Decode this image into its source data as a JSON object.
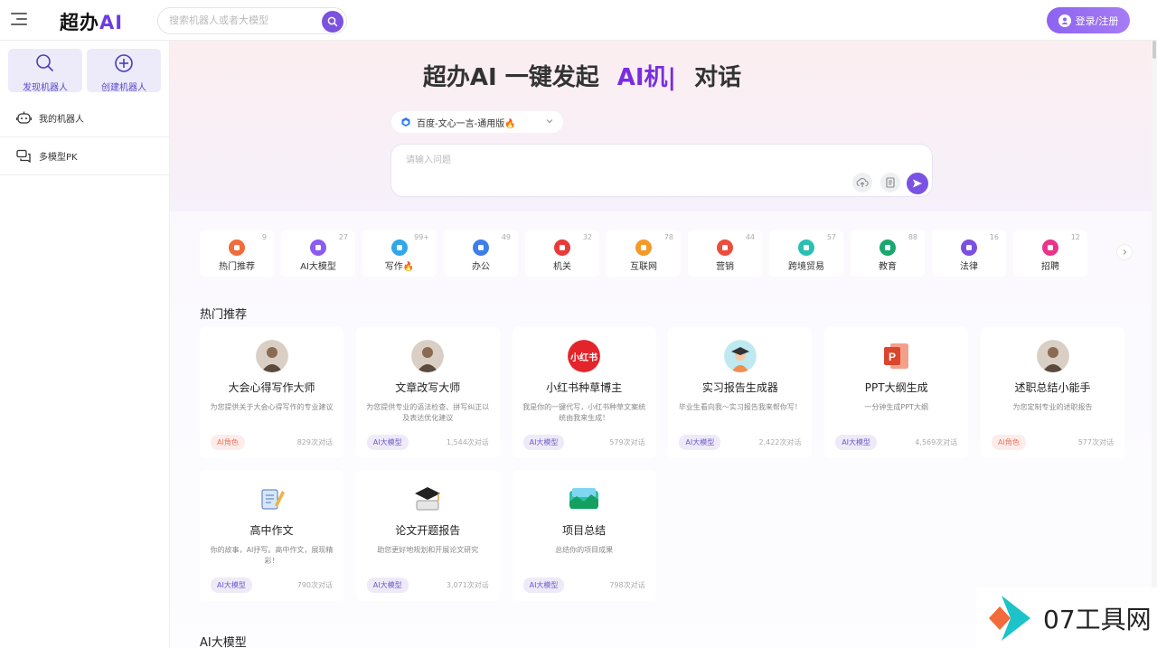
{
  "header": {
    "logo_text": "超办",
    "logo_ai": "AI",
    "search_placeholder": "搜索机器人或者大模型",
    "login_label": "登录/注册"
  },
  "sidebar": {
    "cards": [
      {
        "label": "发现机器人",
        "icon": "search-icon"
      },
      {
        "label": "创建机器人",
        "icon": "plus-circle-icon"
      }
    ],
    "items": [
      {
        "label": "我的机器人",
        "icon": "robot-icon"
      },
      {
        "label": "多模型PK",
        "icon": "chat-bubbles-icon"
      }
    ]
  },
  "hero": {
    "title_prefix": "超办AI 一键发起",
    "title_highlight": "AI机|",
    "title_suffix": "对话",
    "model_selected": "百度-文心一言-通用版🔥",
    "input_placeholder": "请输入问题"
  },
  "categories": [
    {
      "label": "热门推荐",
      "count": "9",
      "color": "#f26b3a"
    },
    {
      "label": "AI大模型",
      "count": "27",
      "color": "#8a5cf0"
    },
    {
      "label": "写作🔥",
      "count": "99+",
      "color": "#2fa7e8"
    },
    {
      "label": "办公",
      "count": "49",
      "color": "#3d7ee8"
    },
    {
      "label": "机关",
      "count": "32",
      "color": "#e83a3a"
    },
    {
      "label": "互联网",
      "count": "78",
      "color": "#f39a2a"
    },
    {
      "label": "营销",
      "count": "44",
      "color": "#ea4e3c"
    },
    {
      "label": "跨境贸易",
      "count": "57",
      "color": "#2bbfb1"
    },
    {
      "label": "教育",
      "count": "88",
      "color": "#18a870"
    },
    {
      "label": "法律",
      "count": "16",
      "color": "#7b50e0"
    },
    {
      "label": "招聘",
      "count": "12",
      "color": "#e8358a"
    }
  ],
  "section_hot": "热门推荐",
  "section_ai": "AI大模型",
  "cards": [
    {
      "name": "大会心得写作大师",
      "desc": "为您提供关于大会心得写作的专业建议",
      "tag": "AI角色",
      "count": "829次对话",
      "icon": "avatar-portrait"
    },
    {
      "name": "文章改写大师",
      "desc": "为您提供专业的语法检查、拼写纠正以及表达优化建议",
      "tag": "AI大模型",
      "count": "1,544次对话",
      "icon": "avatar-portrait"
    },
    {
      "name": "小红书种草博主",
      "desc": "我是你的一键代写，小红书种草文案统统由我来生成！",
      "tag": "AI大模型",
      "count": "579次对话",
      "icon": "xiaohongshu-logo",
      "logo_text": "小红书"
    },
    {
      "name": "实习报告生成器",
      "desc": "毕业生看向我～实习报告我来帮你写！",
      "tag": "AI大模型",
      "count": "2,422次对话",
      "icon": "graduate-icon"
    },
    {
      "name": "PPT大纲生成",
      "desc": "一分钟生成PPT大纲",
      "tag": "AI大模型",
      "count": "4,569次对话",
      "icon": "ppt-icon"
    },
    {
      "name": "述职总结小能手",
      "desc": "为您定制专业的述职报告",
      "tag": "AI角色",
      "count": "577次对话",
      "icon": "avatar-portrait"
    },
    {
      "name": "高中作文",
      "desc": "你的故事，AI抒写。高中作文，展现精彩！",
      "tag": "AI大模型",
      "count": "790次对话",
      "icon": "notebook-pen-icon"
    },
    {
      "name": "论文开题报告",
      "desc": "助您更好地规划和开展论文研究",
      "tag": "AI大模型",
      "count": "3,071次对话",
      "icon": "grad-cap-book-icon"
    },
    {
      "name": "项目总结",
      "desc": "总结你的项目成果",
      "tag": "AI大模型",
      "count": "798次对话",
      "icon": "project-icon"
    }
  ],
  "watermark": "07工具网"
}
